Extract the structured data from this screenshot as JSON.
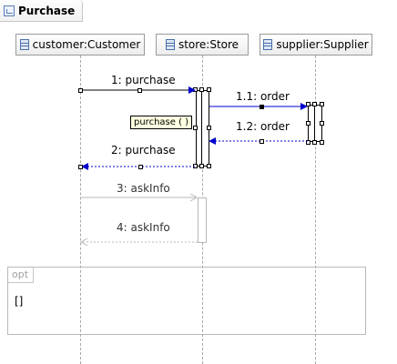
{
  "diagram": {
    "title": "Purchase",
    "lifelines": [
      {
        "id": "customer",
        "label": "customer:Customer"
      },
      {
        "id": "store",
        "label": "store:Store"
      },
      {
        "id": "supplier",
        "label": "supplier:Supplier"
      }
    ],
    "messages": [
      {
        "id": "m1",
        "label": "1: purchase",
        "from": "customer",
        "to": "store",
        "kind": "call"
      },
      {
        "id": "m11",
        "label": "1.1: order",
        "from": "store",
        "to": "supplier",
        "kind": "call"
      },
      {
        "id": "m12",
        "label": "1.2: order",
        "from": "supplier",
        "to": "store",
        "kind": "reply"
      },
      {
        "id": "m2",
        "label": "2: purchase",
        "from": "store",
        "to": "customer",
        "kind": "reply"
      },
      {
        "id": "m3",
        "label": "3: askInfo",
        "from": "customer",
        "to": "store",
        "kind": "call",
        "muted": true
      },
      {
        "id": "m4",
        "label": "4: askInfo",
        "from": "store",
        "to": "customer",
        "kind": "reply",
        "muted": true
      }
    ],
    "tooltip": "purchase ( )",
    "fragment": {
      "operator": "opt",
      "guard": "[]"
    },
    "colors": {
      "selection": "#0000cc",
      "muted": "#b8b8b8",
      "lifeline": "#a8a8a8"
    }
  }
}
